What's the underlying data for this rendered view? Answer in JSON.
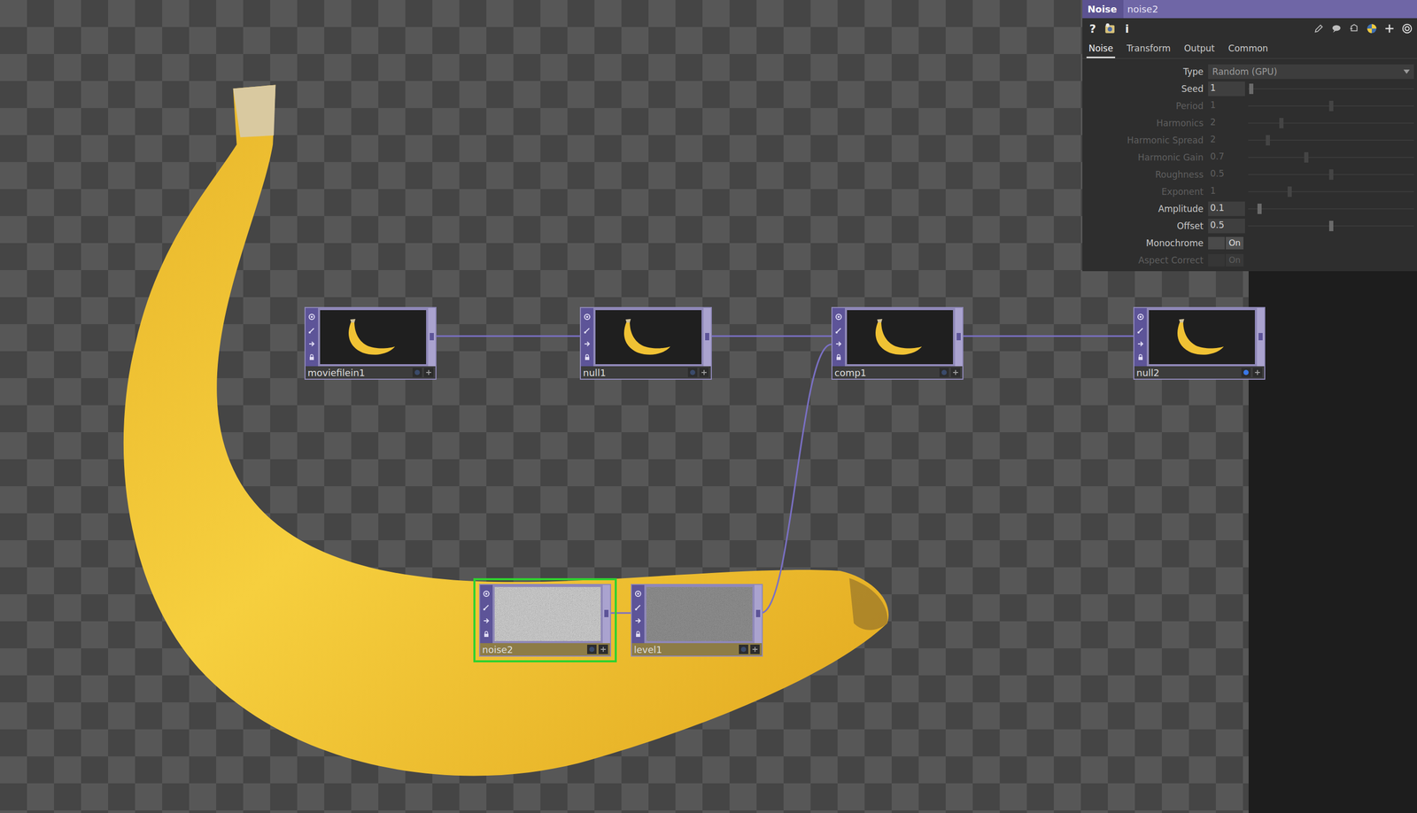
{
  "nodes": [
    {
      "name": "moviefilein1",
      "kind": "banana",
      "selected": false,
      "display": false,
      "tinted": false
    },
    {
      "name": "null1",
      "kind": "banana",
      "selected": false,
      "display": false,
      "tinted": false
    },
    {
      "name": "comp1",
      "kind": "banana",
      "selected": false,
      "display": false,
      "tinted": false
    },
    {
      "name": "null2",
      "kind": "banana",
      "selected": false,
      "display": true,
      "tinted": false
    },
    {
      "name": "noise2",
      "kind": "noise",
      "selected": true,
      "display": false,
      "tinted": true
    },
    {
      "name": "level1",
      "kind": "dark",
      "selected": false,
      "display": false,
      "tinted": true
    }
  ],
  "wires": [
    {
      "from": 0,
      "to": 1,
      "input": 0
    },
    {
      "from": 1,
      "to": 2,
      "input": 0
    },
    {
      "from": 2,
      "to": 3,
      "input": 0
    },
    {
      "from": 4,
      "to": 5,
      "input": 0
    },
    {
      "from": 5,
      "to": 2,
      "input": 1
    }
  ],
  "panel": {
    "type_label": "Noise",
    "node_name": "noise2",
    "help": "?",
    "info": "i",
    "tabs": [
      {
        "label": "Noise",
        "selected": true
      },
      {
        "label": "Transform",
        "selected": false
      },
      {
        "label": "Output",
        "selected": false
      },
      {
        "label": "Common",
        "selected": false
      }
    ],
    "params": [
      {
        "label": "Type",
        "kind": "menu",
        "value": "Random (GPU)",
        "disabled": false
      },
      {
        "label": "Seed",
        "kind": "slider",
        "value": "1",
        "disabled": false,
        "level": 0.02
      },
      {
        "label": "Period",
        "kind": "slider",
        "value": "1",
        "disabled": true,
        "level": 0.5
      },
      {
        "label": "Harmonics",
        "kind": "slider",
        "value": "2",
        "disabled": true,
        "level": 0.2
      },
      {
        "label": "Harmonic Spread",
        "kind": "slider",
        "value": "2",
        "disabled": true,
        "level": 0.12
      },
      {
        "label": "Harmonic Gain",
        "kind": "slider",
        "value": "0.7",
        "disabled": true,
        "level": 0.35
      },
      {
        "label": "Roughness",
        "kind": "slider",
        "value": "0.5",
        "disabled": true,
        "level": 0.5
      },
      {
        "label": "Exponent",
        "kind": "slider",
        "value": "1",
        "disabled": true,
        "level": 0.25
      },
      {
        "label": "Amplitude",
        "kind": "slider",
        "value": "0.1",
        "disabled": false,
        "level": 0.07
      },
      {
        "label": "Offset",
        "kind": "slider",
        "value": "0.5",
        "disabled": false,
        "level": 0.5
      },
      {
        "label": "Monochrome",
        "kind": "toggle",
        "value": "On",
        "disabled": false,
        "on": true
      },
      {
        "label": "Aspect Correct",
        "kind": "toggle",
        "value": "On",
        "disabled": true,
        "on": true
      }
    ]
  }
}
